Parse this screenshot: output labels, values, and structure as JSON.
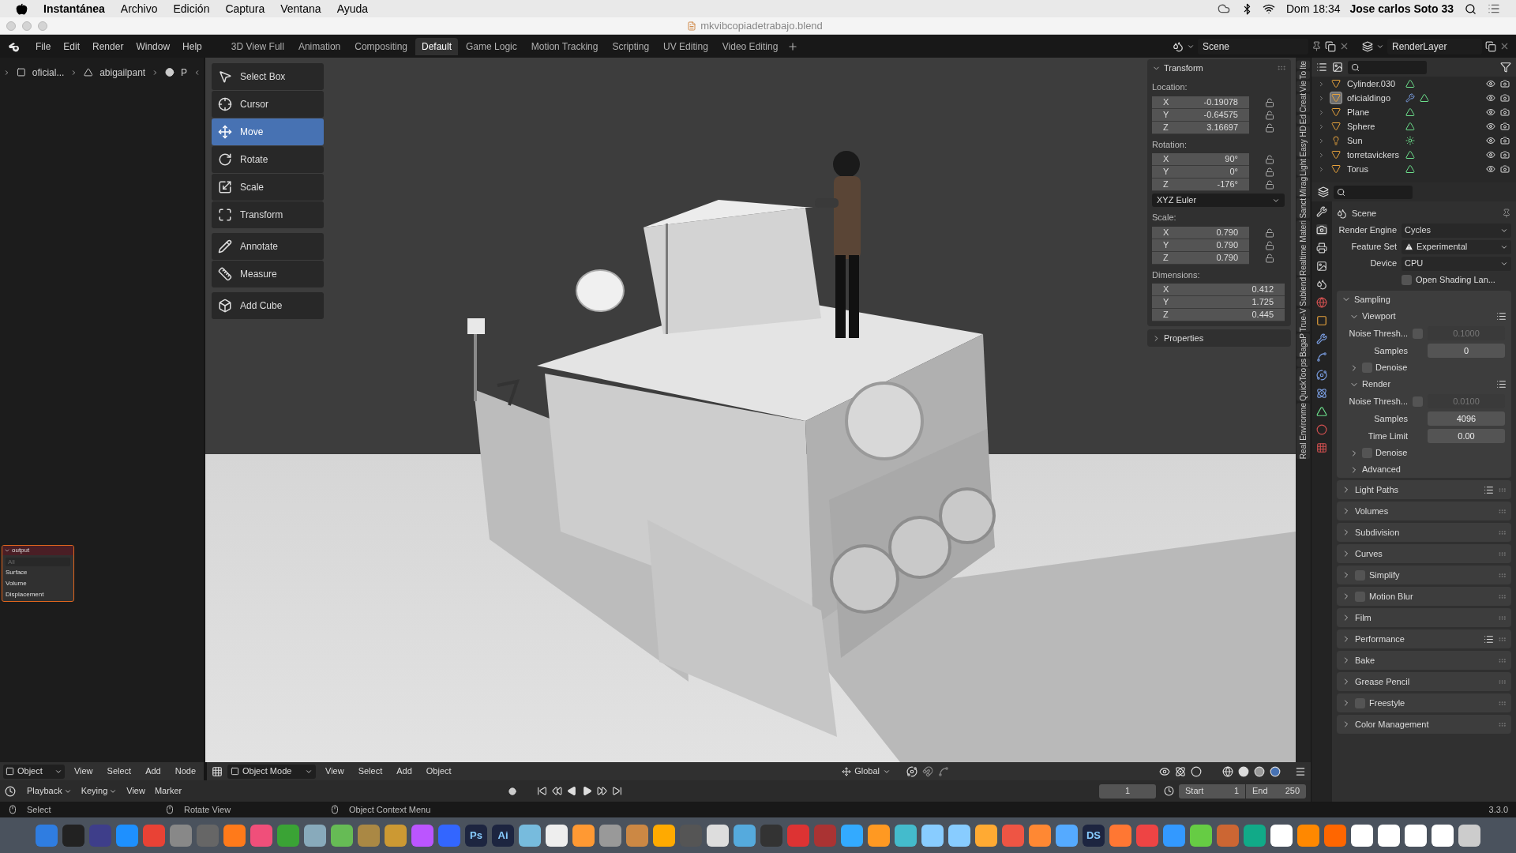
{
  "menu_bar": {
    "app": "Instantánea",
    "items": [
      "Archivo",
      "Edición",
      "Captura",
      "Ventana",
      "Ayuda"
    ],
    "clock": "Dom 18:34",
    "user": "Jose carlos Soto 33"
  },
  "window": {
    "title": "mkvibcopiadetrabajo.blend"
  },
  "top_bar": {
    "menus": [
      "File",
      "Edit",
      "Render",
      "Window",
      "Help"
    ],
    "workspaces": [
      {
        "label": "3D View Full",
        "selected": false
      },
      {
        "label": "Animation",
        "selected": false
      },
      {
        "label": "Compositing",
        "selected": false
      },
      {
        "label": "Default",
        "selected": true
      },
      {
        "label": "Game Logic",
        "selected": false
      },
      {
        "label": "Motion Tracking",
        "selected": false
      },
      {
        "label": "Scripting",
        "selected": false
      },
      {
        "label": "UV Editing",
        "selected": false
      },
      {
        "label": "Video Editing",
        "selected": false
      }
    ],
    "scene": "Scene",
    "view_layer": "RenderLayer"
  },
  "node_editor": {
    "breadcrumbs": [
      "oficial...",
      "abigailpant",
      "P"
    ],
    "output_node": {
      "title": "output",
      "target": "All",
      "sockets": [
        "Surface",
        "Volume",
        "Displacement"
      ]
    },
    "header": {
      "editor": "Object",
      "menus": [
        "View",
        "Select",
        "Add",
        "Node"
      ]
    }
  },
  "toolbar": {
    "groups": [
      [
        {
          "label": "Select Box",
          "selected": false
        },
        {
          "label": "Cursor",
          "selected": false
        },
        {
          "label": "Move",
          "selected": true
        },
        {
          "label": "Rotate",
          "selected": false
        },
        {
          "label": "Scale",
          "selected": false
        },
        {
          "label": "Transform",
          "selected": false
        }
      ],
      [
        {
          "label": "Annotate",
          "selected": false
        },
        {
          "label": "Measure",
          "selected": false
        }
      ],
      [
        {
          "label": "Add Cube",
          "selected": false
        }
      ]
    ]
  },
  "transform_panel": {
    "title": "Transform",
    "expanded": true,
    "groups": [
      {
        "label": "Location:",
        "rows": [
          {
            "axis": "X",
            "value": "-0.19078",
            "locked": false
          },
          {
            "axis": "Y",
            "value": "-0.64575",
            "locked": false
          },
          {
            "axis": "Z",
            "value": "3.16697",
            "locked": false
          }
        ]
      },
      {
        "label": "Rotation:",
        "rows": [
          {
            "axis": "X",
            "value": "90°",
            "locked": false
          },
          {
            "axis": "Y",
            "value": "0°",
            "locked": false
          },
          {
            "axis": "Z",
            "value": "-176°",
            "locked": false
          }
        ],
        "mode": "XYZ Euler"
      },
      {
        "label": "Scale:",
        "rows": [
          {
            "axis": "X",
            "value": "0.790",
            "locked": false
          },
          {
            "axis": "Y",
            "value": "0.790",
            "locked": false
          },
          {
            "axis": "Z",
            "value": "0.790",
            "locked": false
          }
        ]
      },
      {
        "label": "Dimensions:",
        "rows": [
          {
            "axis": "X",
            "value": "0.412"
          },
          {
            "axis": "Y",
            "value": "1.725"
          },
          {
            "axis": "Z",
            "value": "0.445"
          }
        ]
      }
    ],
    "properties": {
      "title": "Properties",
      "expanded": false
    }
  },
  "side_tabs": [
    "lte",
    "To",
    "Vie",
    "Creat",
    "Ed",
    "Easy HD",
    "Light",
    "Mirag",
    "Sanct",
    "Realtime Materi",
    "Sublend",
    "True-V",
    "BagaP",
    "ps",
    "QuickToo",
    "Real Environme"
  ],
  "viewport_header": {
    "mode": "Object Mode",
    "menus": [
      "View",
      "Select",
      "Add",
      "Object"
    ],
    "orientation": "Global"
  },
  "outliner": {
    "items": [
      {
        "name": "Cylinder.030",
        "kind": "mesh",
        "active": false
      },
      {
        "name": "oficialdingo",
        "kind": "mesh",
        "active": true,
        "modifiers": true
      },
      {
        "name": "Plane",
        "kind": "mesh",
        "active": false
      },
      {
        "name": "Sphere",
        "kind": "mesh",
        "active": false
      },
      {
        "name": "Sun",
        "kind": "light",
        "active": false
      },
      {
        "name": "torretavickers",
        "kind": "mesh",
        "active": false
      },
      {
        "name": "Torus",
        "kind": "mesh",
        "active": false
      }
    ]
  },
  "properties": {
    "context": "Scene",
    "settings": [
      {
        "label": "Render Engine",
        "value": "Cycles",
        "warning": false
      },
      {
        "label": "Feature Set",
        "value": "Experimental",
        "warning": true
      },
      {
        "label": "Device",
        "value": "CPU",
        "warning": false
      }
    ],
    "open_shading": {
      "label": "Open Shading Lan...",
      "checked": false
    },
    "sampling": {
      "title": "Sampling",
      "expanded": true,
      "subpanels": [
        {
          "title": "Viewport",
          "expanded": true,
          "fields": [
            {
              "label": "Noise Thresh...",
              "kind": "toggled",
              "checked": false,
              "value": "0.1000"
            },
            {
              "label": "Samples",
              "kind": "number",
              "value": "0"
            }
          ],
          "denoise": {
            "label": "Denoise",
            "checked": false,
            "expanded": false
          }
        },
        {
          "title": "Render",
          "expanded": true,
          "fields": [
            {
              "label": "Noise Thresh...",
              "kind": "toggled",
              "checked": false,
              "value": "0.0100"
            },
            {
              "label": "Samples",
              "kind": "number",
              "value": "4096"
            },
            {
              "label": "Time Limit",
              "kind": "number",
              "value": "0.00"
            }
          ],
          "denoise": {
            "label": "Denoise",
            "checked": false,
            "expanded": false
          }
        }
      ],
      "advanced": {
        "title": "Advanced",
        "expanded": false
      }
    },
    "panels": [
      {
        "label": "Light Paths",
        "expanded": false,
        "presets": true
      },
      {
        "label": "Volumes",
        "expanded": false
      },
      {
        "label": "Subdivision",
        "expanded": false
      },
      {
        "label": "Curves",
        "expanded": false
      },
      {
        "label": "Simplify",
        "expanded": false,
        "checked": false
      },
      {
        "label": "Motion Blur",
        "expanded": false,
        "checked": false
      },
      {
        "label": "Film",
        "expanded": false
      },
      {
        "label": "Performance",
        "expanded": false,
        "presets": true
      },
      {
        "label": "Bake",
        "expanded": false
      },
      {
        "label": "Grease Pencil",
        "expanded": false
      },
      {
        "label": "Freestyle",
        "expanded": false,
        "checked": false
      },
      {
        "label": "Color Management",
        "expanded": false
      }
    ]
  },
  "timeline": {
    "menus": [
      "Playback",
      "Keying",
      "View",
      "Marker"
    ],
    "current_frame": "1",
    "start": {
      "label": "Start",
      "value": "1"
    },
    "end": {
      "label": "End",
      "value": "250"
    }
  },
  "status_bar": {
    "hints": [
      "Select",
      "Rotate View",
      "Object Context Menu"
    ],
    "version": "3.3.0"
  },
  "dock": {
    "lettered_icons": [
      "Ps",
      "Ai",
      "DS"
    ]
  }
}
